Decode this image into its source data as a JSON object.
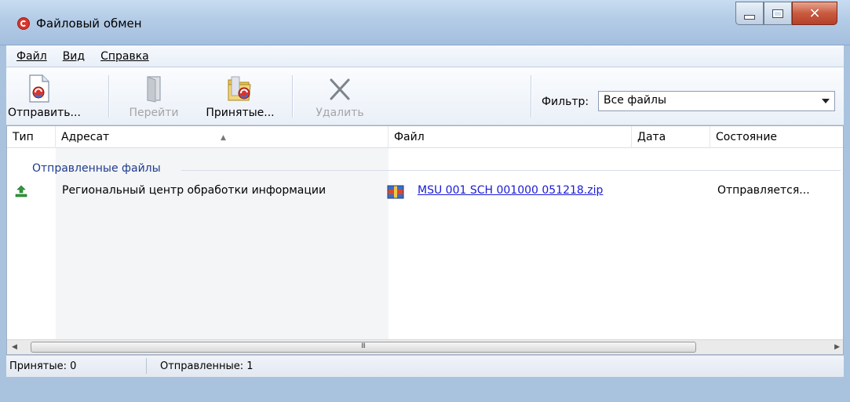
{
  "window": {
    "title": "Файловый обмен"
  },
  "menu": {
    "items": [
      {
        "label": "Файл"
      },
      {
        "label": "Вид"
      },
      {
        "label": "Справка"
      }
    ]
  },
  "toolbar": {
    "send_label": "Отправить...",
    "goto_label": "Перейти",
    "received_label": "Принятые...",
    "delete_label": "Удалить",
    "filter_label": "Фильтр:",
    "filter_value": "Все файлы"
  },
  "table": {
    "columns": [
      "Тип",
      "Адресат",
      "Файл",
      "Дата",
      "Состояние"
    ],
    "group_header": "Отправленные файлы",
    "rows": [
      {
        "type_icon": "upload-icon",
        "recipient": "Региональный центр обработки информации",
        "file_icon": "archive-icon",
        "file": "MSU 001 SCH 001000 051218.zip",
        "date": "",
        "state": "Отправляется..."
      }
    ]
  },
  "scrollbar": {
    "grip": "III"
  },
  "status": {
    "received": "Принятые: 0",
    "sent": "Отправленные: 1"
  },
  "colors": {
    "accent": "#1e3b8d",
    "link": "#1a1ad6",
    "close_button": "#c95a3f"
  }
}
